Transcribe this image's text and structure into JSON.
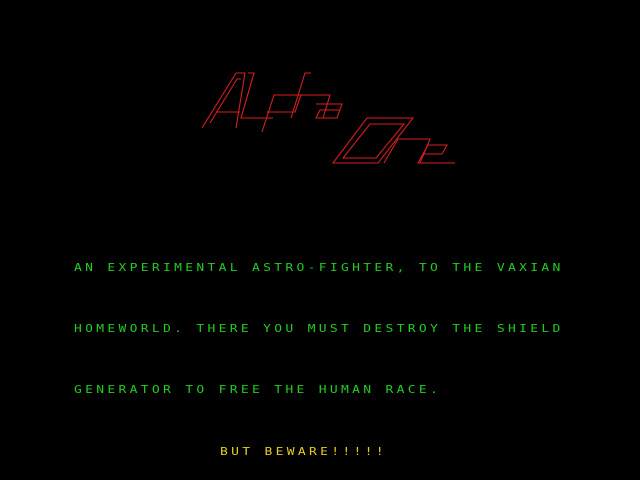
{
  "title": {
    "word1": "Alpha",
    "word2": "One",
    "color": "#d81e1e"
  },
  "story": {
    "color": "#22cc22",
    "lines": [
      "AN EXPERIMENTAL ASTRO-FIGHTER, TO THE VAXIAN",
      "HOMEWORLD. THERE YOU MUST DESTROY THE SHIELD",
      "GENERATOR TO FREE THE HUMAN RACE."
    ]
  },
  "warning": {
    "text": "BUT BEWARE!!!!!",
    "color": "#e6cc1e"
  },
  "background": "#000000"
}
